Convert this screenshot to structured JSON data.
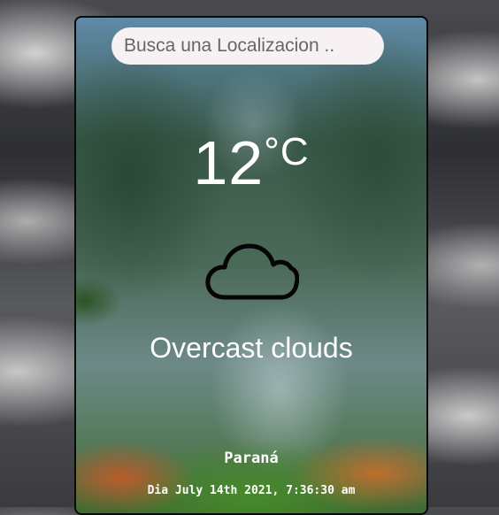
{
  "search": {
    "placeholder": "Busca una Localizacion ..",
    "value": ""
  },
  "weather": {
    "temperature": "12",
    "unit": "°C",
    "icon": "cloud-icon",
    "description": "Overcast clouds",
    "city": "Paraná",
    "date": "Dia July 14th 2021, 7:36:30 am"
  }
}
